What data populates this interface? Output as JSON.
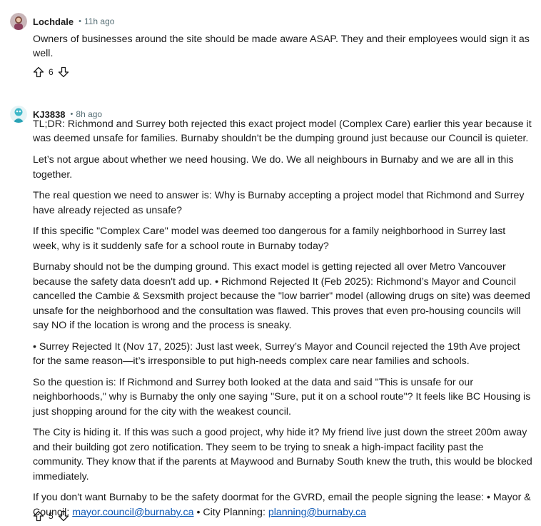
{
  "comments": [
    {
      "author": "Lochdale",
      "separator": "•",
      "time": "11h ago",
      "avatar_icon": "user-avatar-icon",
      "paragraphs": [
        "Owners of businesses around the site should be made aware ASAP. They and their employees would sign it as well."
      ],
      "votes": "6"
    },
    {
      "author": "KJ3838",
      "separator": "•",
      "time": "8h ago",
      "avatar_icon": "user-avatar-icon",
      "paragraphs": [
        "TL;DR: Richmond and Surrey both rejected this exact project model (Complex Care) earlier this year because it was deemed unsafe for families. Burnaby shouldn't be the dumping ground just because our Council is quieter.",
        "Let’s not argue about whether we need housing. We do. We all neighbours in Burnaby and we are all in this together.",
        "The real question we need to answer is: Why is Burnaby accepting a project model that Richmond and Surrey have already rejected as unsafe?",
        "If this specific \"Complex Care\" model was deemed too dangerous for a family neighborhood in Surrey last week, why is it suddenly safe for a school route in Burnaby today?",
        "Burnaby should not be the dumping ground. This exact model is getting rejected all over Metro Vancouver because the safety data doesn't add up. • Richmond Rejected It (Feb 2025): Richmond’s Mayor and Council cancelled the Cambie & Sexsmith project because the \"low barrier\" model (allowing drugs on site) was deemed unsafe for the neighborhood and the consultation was flawed. This proves that even pro-housing councils will say NO if the location is wrong and the process is sneaky.",
        "• Surrey Rejected It (Nov 17, 2025): Just last week, Surrey’s Mayor and Council rejected the 19th Ave project for the same reason—it’s irresponsible to put high-needs complex care near families and schools.",
        "So the question is: If Richmond and Surrey both looked at the data and said \"This is unsafe for our neighborhoods,\" why is Burnaby the only one saying \"Sure, put it on a school route\"? It feels like BC Housing is just shopping around for the city with the weakest council.",
        "The City is hiding it. If this was such a good project, why hide it? My friend live just down the street 200m away and their building got zero notification. They seem to be trying to sneak a high-impact facility past the community. They know that if the parents at Maywood and Burnaby South knew the truth, this would be blocked immediately."
      ],
      "last_paragraph": {
        "text_before": "If you don't want Burnaby to be the safety doormat for the GVRD, email the people signing the lease: • Mayor & Council: ",
        "link1": "mayor.council@burnaby.ca",
        "text_middle": " • City Planning: ",
        "link2": "planning@burnaby.ca"
      },
      "votes": "5"
    }
  ],
  "icons": {
    "upvote": "upvote-arrow-icon",
    "downvote": "downvote-arrow-icon"
  }
}
